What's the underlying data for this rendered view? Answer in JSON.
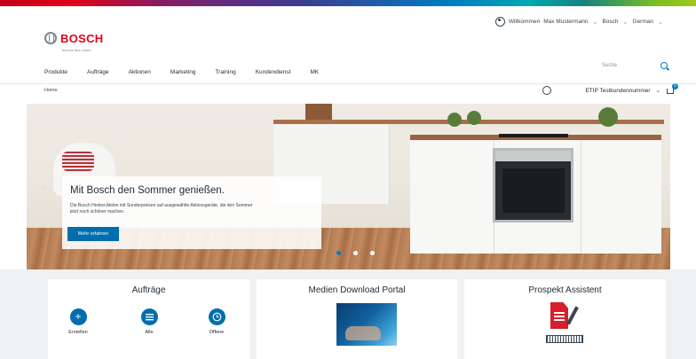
{
  "header": {
    "user": {
      "greeting": "Willkommen",
      "name": "Max Mustermann"
    },
    "company": "Bosch",
    "language": "German",
    "logo_text": "BOSCH",
    "logo_tagline": "Technik fürs Leben",
    "nav": [
      "Produkte",
      "Aufträge",
      "Aktionen",
      "Marketing",
      "Training",
      "Kundendienst",
      "MK"
    ],
    "search_placeholder": "Suche"
  },
  "breadcrumb": "Home",
  "toolbar": {
    "etip_label": "ETIP Testkundennummer",
    "cart_count": "0"
  },
  "hero": {
    "title": "Mit Bosch den Sommer genießen.",
    "text": "Die Bosch Herbst-Aktion mit Sonderpreisen auf ausgewählte Aktionsgeräte, die den Sommer jetzt noch schöner machen.",
    "button": "Mehr erfahren",
    "slides": 3,
    "active_slide": 1
  },
  "cards": {
    "orders": {
      "title": "Aufträge",
      "actions": [
        {
          "label": "Erstellen",
          "icon": "plus-icon"
        },
        {
          "label": "Alle",
          "icon": "list-icon"
        },
        {
          "label": "Offene",
          "icon": "clock-icon"
        }
      ]
    },
    "media": {
      "title": "Medien Download Portal"
    },
    "prospekt": {
      "title": "Prospekt Assistent"
    }
  },
  "colors": {
    "brand_red": "#e20015",
    "accent_blue": "#006ead"
  }
}
